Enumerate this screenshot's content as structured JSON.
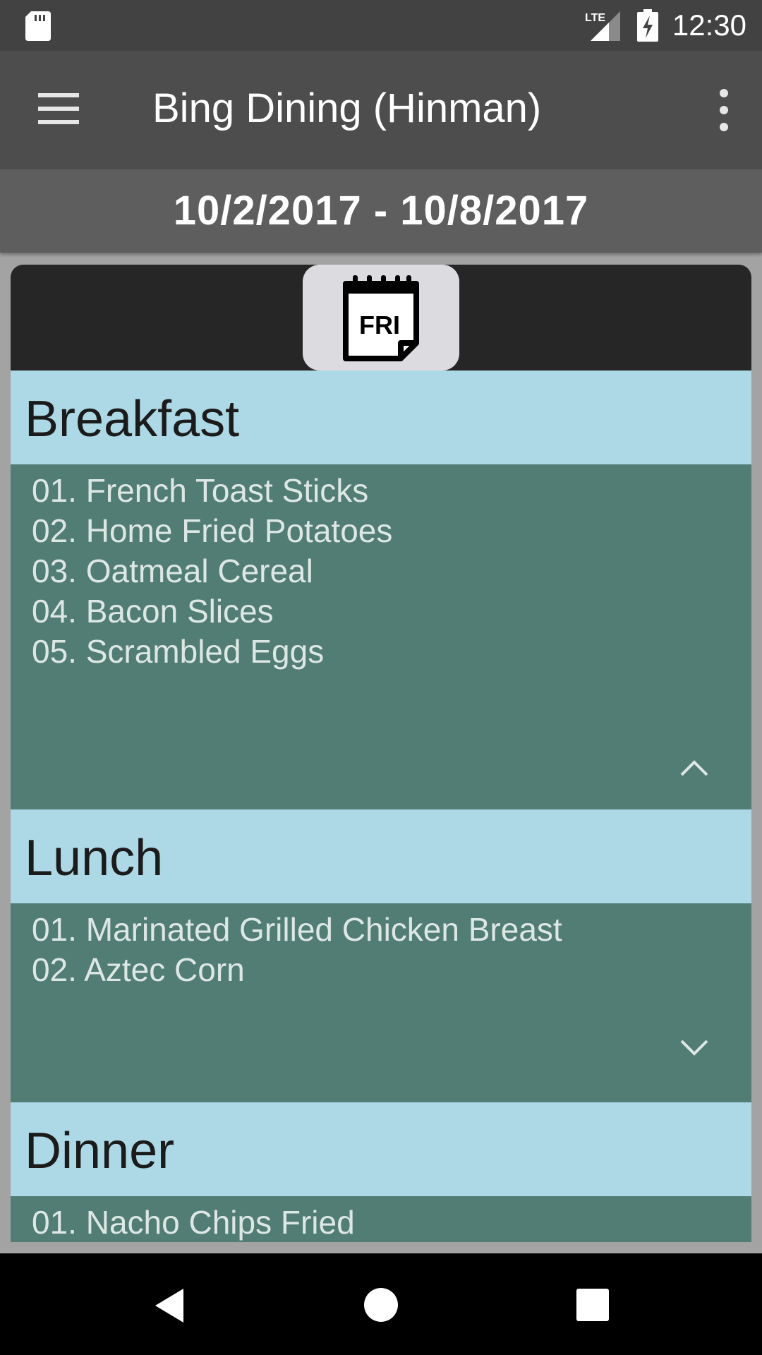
{
  "status_bar": {
    "network": "LTE",
    "time": "12:30"
  },
  "app_bar": {
    "title": "Bing Dining (Hinman)"
  },
  "date_range": "10/2/2017 - 10/8/2017",
  "day_selector": {
    "label": "FRI"
  },
  "meals": {
    "breakfast": {
      "title": "Breakfast",
      "expanded": true,
      "items": [
        "01. French Toast Sticks",
        "02. Home Fried Potatoes",
        "03. Oatmeal Cereal",
        "04. Bacon Slices",
        "05. Scrambled Eggs"
      ]
    },
    "lunch": {
      "title": "Lunch",
      "expanded": false,
      "items": [
        "01. Marinated Grilled Chicken Breast",
        "02. Aztec Corn"
      ]
    },
    "dinner": {
      "title": "Dinner",
      "items": [
        "01. Nacho Chips Fried"
      ]
    }
  },
  "colors": {
    "status_bar": "#424242",
    "app_bar": "#4d4d4d",
    "date_bar": "#5e5e5e",
    "section_header": "#add8e6",
    "section_body": "#517d75"
  }
}
